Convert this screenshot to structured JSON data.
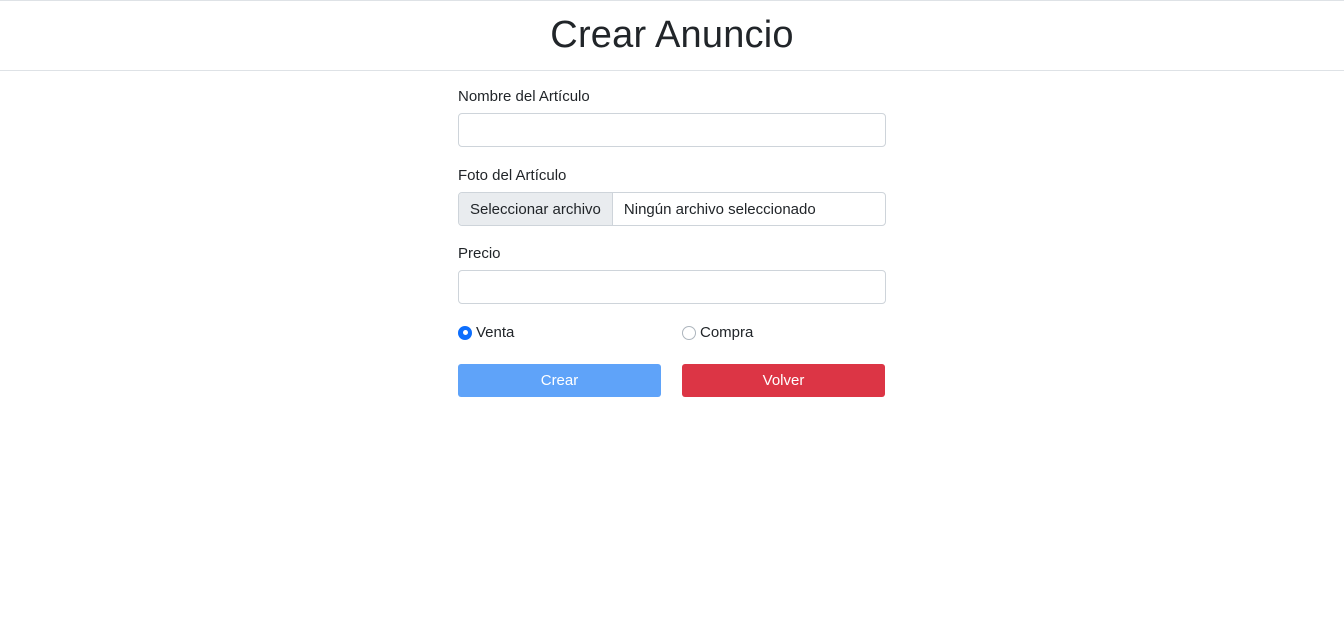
{
  "header": {
    "title": "Crear Anuncio"
  },
  "form": {
    "name_label": "Nombre del Artículo",
    "name_value": "",
    "photo_label": "Foto del Artículo",
    "file_button": "Seleccionar archivo",
    "file_status": "Ningún archivo seleccionado",
    "price_label": "Precio",
    "price_value": "",
    "radio_options": [
      {
        "label": "Venta",
        "checked": true
      },
      {
        "label": "Compra",
        "checked": false
      }
    ],
    "submit_label": "Crear",
    "back_label": "Volver"
  },
  "colors": {
    "primary": "#5fa3f9",
    "danger": "#dc3545",
    "radio_checked": "#0d6efd"
  }
}
